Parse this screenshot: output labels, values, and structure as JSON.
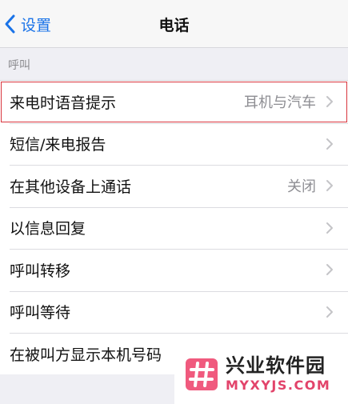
{
  "nav": {
    "back_label": "设置",
    "title": "电话"
  },
  "section": {
    "header": "呼叫"
  },
  "rows": [
    {
      "label": "来电时语音提示",
      "value": "耳机与汽车"
    },
    {
      "label": "短信/来电报告",
      "value": ""
    },
    {
      "label": "在其他设备上通话",
      "value": "关闭"
    },
    {
      "label": "以信息回复",
      "value": ""
    },
    {
      "label": "呼叫转移",
      "value": ""
    },
    {
      "label": "呼叫等待",
      "value": ""
    },
    {
      "label": "在被叫方显示本机号码",
      "value": ""
    }
  ],
  "watermark": {
    "name_cn": "兴业软件园",
    "name_en": "MYXYJS.COM"
  },
  "colors": {
    "accent": "#1a73e8",
    "highlight_border": "#d9363e",
    "watermark_pink": "#e2436a"
  },
  "icons": {
    "back": "chevron-left-icon",
    "row_disclosure": "chevron-right-icon",
    "watermark_logo": "hash-logo-icon"
  }
}
